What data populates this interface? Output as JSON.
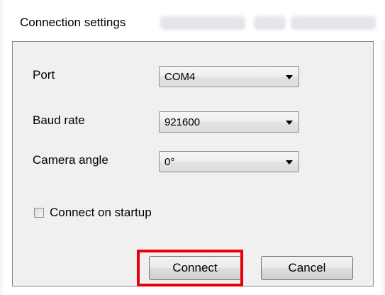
{
  "dialog": {
    "title": "Connection settings"
  },
  "form": {
    "port": {
      "label": "Port",
      "value": "COM4"
    },
    "baud_rate": {
      "label": "Baud rate",
      "value": "921600"
    },
    "camera_angle": {
      "label": "Camera angle",
      "value": "0°"
    },
    "connect_on_startup": {
      "label": "Connect on startup",
      "checked": false
    }
  },
  "buttons": {
    "connect_label": "Connect",
    "cancel_label": "Cancel"
  },
  "highlight": {
    "target": "connect-button",
    "color": "#e8000b"
  },
  "icons": {
    "dropdown": "chevron-down-icon",
    "checkbox": "checkbox-icon"
  }
}
